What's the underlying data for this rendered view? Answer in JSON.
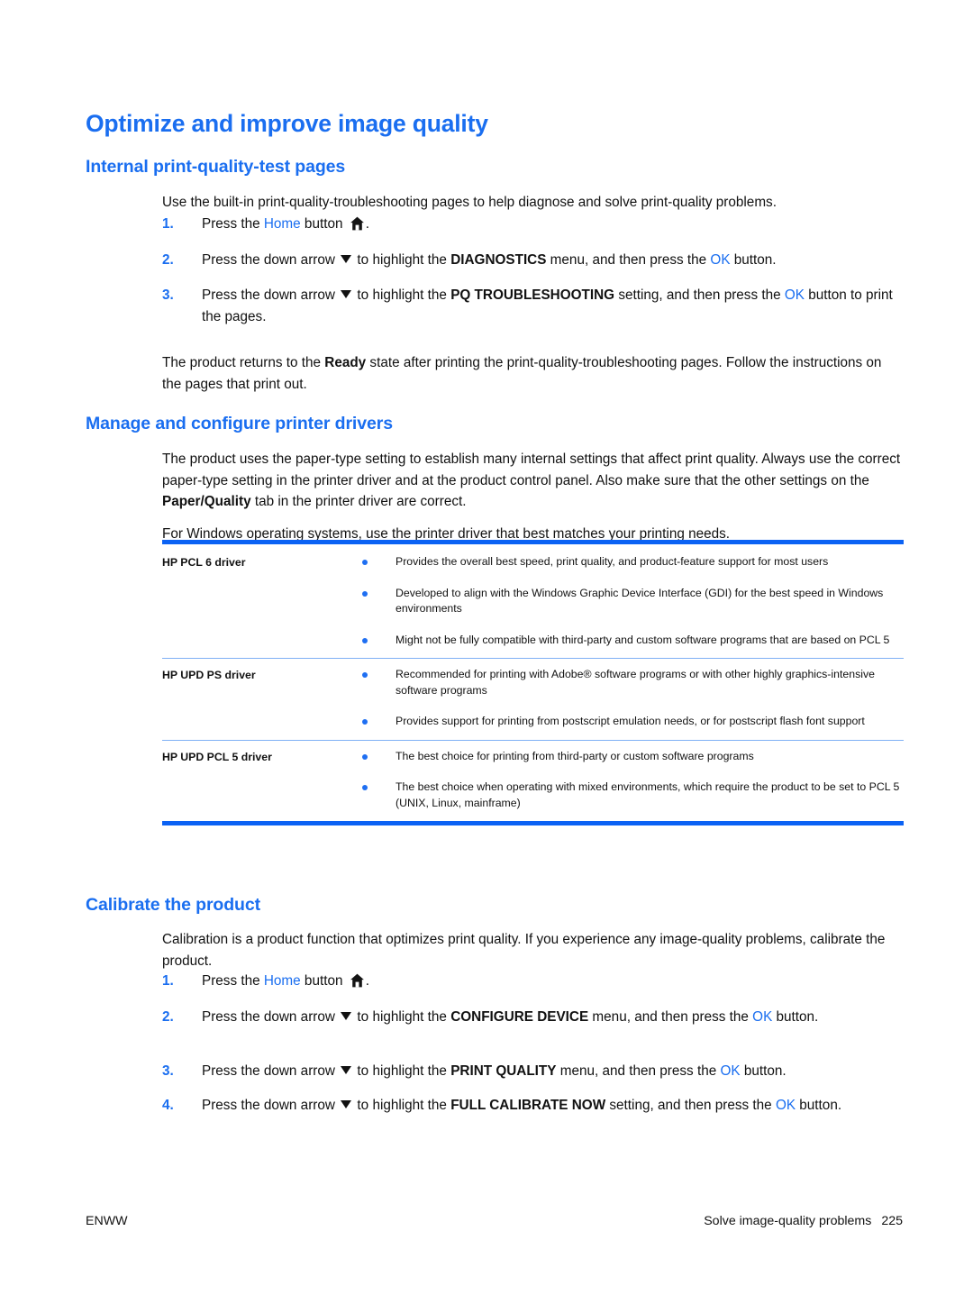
{
  "page": {
    "title": "Optimize and improve image quality",
    "footer_left": "ENWW",
    "footer_right_text": "Solve image-quality problems",
    "footer_page_number": "225"
  },
  "colors": {
    "heading_blue": "#1a6ef0",
    "rule_blue": "#0b62f4",
    "row_divider": "#7fb0f5",
    "bullet_blue": "#1f6ff2",
    "body_text": "#111111"
  },
  "sections": {
    "internal": {
      "heading": "Internal print-quality-test pages",
      "intro": "Use the built-in print-quality-troubleshooting pages to help diagnose and solve print-quality problems.",
      "steps": [
        {
          "num": "1.",
          "parts": [
            {
              "t": "Press the ",
              "style": "plain"
            },
            {
              "t": "Home",
              "style": "blue"
            },
            {
              "t": " button ",
              "style": "plain"
            },
            {
              "t": "home-icon",
              "style": "icon-home"
            },
            {
              "t": ".",
              "style": "plain"
            }
          ]
        },
        {
          "num": "2.",
          "parts": [
            {
              "t": "Press the down arrow ",
              "style": "plain"
            },
            {
              "t": "down-arrow-icon",
              "style": "icon-down"
            },
            {
              "t": " to highlight the ",
              "style": "plain"
            },
            {
              "t": "DIAGNOSTICS",
              "style": "bold"
            },
            {
              "t": " menu, and then press the ",
              "style": "plain"
            },
            {
              "t": "OK",
              "style": "blue"
            },
            {
              "t": " button.",
              "style": "plain"
            }
          ]
        },
        {
          "num": "3.",
          "parts": [
            {
              "t": "Press the down arrow ",
              "style": "plain"
            },
            {
              "t": "down-arrow-icon",
              "style": "icon-down"
            },
            {
              "t": " to highlight the ",
              "style": "plain"
            },
            {
              "t": "PQ TROUBLESHOOTING",
              "style": "bold"
            },
            {
              "t": " setting, and then press the ",
              "style": "plain"
            },
            {
              "t": "OK",
              "style": "blue"
            },
            {
              "t": " button to print the pages.",
              "style": "plain"
            }
          ]
        }
      ],
      "outro_parts": [
        {
          "t": "The product returns to the ",
          "style": "plain"
        },
        {
          "t": "Ready",
          "style": "bold"
        },
        {
          "t": " state after printing the print-quality-troubleshooting pages. Follow the instructions on the pages that print out.",
          "style": "plain"
        }
      ]
    },
    "manage": {
      "heading": "Manage and configure printer drivers",
      "para1_parts": [
        {
          "t": "The product uses the paper-type setting to establish many internal settings that affect print quality. Always use the correct paper-type setting in the printer driver and at the product control panel. Also make sure that the other settings on the ",
          "style": "plain"
        },
        {
          "t": "Paper/Quality",
          "style": "bold"
        },
        {
          "t": " tab in the printer driver are correct.",
          "style": "plain"
        }
      ],
      "para2": "For Windows operating systems, use the printer driver that best matches your printing needs.",
      "table": {
        "rows": [
          {
            "label": "HP PCL 6 driver",
            "bullets": [
              "Provides the overall best speed, print quality, and product-feature support for most users",
              "Developed to align with the Windows Graphic Device Interface (GDI) for the best speed in Windows environments",
              "Might not be fully compatible with third-party and custom software programs that are based on PCL 5"
            ]
          },
          {
            "label": "HP UPD PS driver",
            "bullets": [
              "Recommended for printing with Adobe® software programs or with other highly graphics-intensive software programs",
              "Provides support for printing from postscript emulation needs, or for postscript flash font support"
            ]
          },
          {
            "label": "HP UPD PCL 5 driver",
            "bullets": [
              "The best choice for printing from third-party or custom software programs",
              "The best choice when operating with mixed environments, which require the product to be set to PCL 5 (UNIX, Linux, mainframe)"
            ]
          }
        ]
      }
    },
    "calibrate": {
      "heading": "Calibrate the product",
      "intro": "Calibration is a product function that optimizes print quality. If you experience any image-quality problems, calibrate the product.",
      "steps": [
        {
          "num": "1.",
          "parts": [
            {
              "t": "Press the ",
              "style": "plain"
            },
            {
              "t": "Home",
              "style": "blue"
            },
            {
              "t": " button ",
              "style": "plain"
            },
            {
              "t": "home-icon",
              "style": "icon-home"
            },
            {
              "t": ".",
              "style": "plain"
            }
          ]
        },
        {
          "num": "2.",
          "parts": [
            {
              "t": "Press the down arrow ",
              "style": "plain"
            },
            {
              "t": "down-arrow-icon",
              "style": "icon-down"
            },
            {
              "t": " to highlight the ",
              "style": "plain"
            },
            {
              "t": "CONFIGURE DEVICE",
              "style": "bold"
            },
            {
              "t": " menu, and then press the ",
              "style": "plain"
            },
            {
              "t": "OK",
              "style": "blue"
            },
            {
              "t": " button.",
              "style": "plain"
            }
          ]
        },
        {
          "num": "3.",
          "parts": [
            {
              "t": "Press the down arrow ",
              "style": "plain"
            },
            {
              "t": "down-arrow-icon",
              "style": "icon-down"
            },
            {
              "t": " to highlight the ",
              "style": "plain"
            },
            {
              "t": "PRINT QUALITY",
              "style": "bold"
            },
            {
              "t": " menu, and then press the ",
              "style": "plain"
            },
            {
              "t": "OK",
              "style": "blue"
            },
            {
              "t": " button.",
              "style": "plain"
            }
          ]
        },
        {
          "num": "4.",
          "parts": [
            {
              "t": "Press the down arrow ",
              "style": "plain"
            },
            {
              "t": "down-arrow-icon",
              "style": "icon-down"
            },
            {
              "t": " to highlight the ",
              "style": "plain"
            },
            {
              "t": "FULL CALIBRATE NOW",
              "style": "bold"
            },
            {
              "t": " setting, and then press the ",
              "style": "plain"
            },
            {
              "t": "OK",
              "style": "blue"
            },
            {
              "t": " button.",
              "style": "plain"
            }
          ]
        }
      ]
    }
  }
}
